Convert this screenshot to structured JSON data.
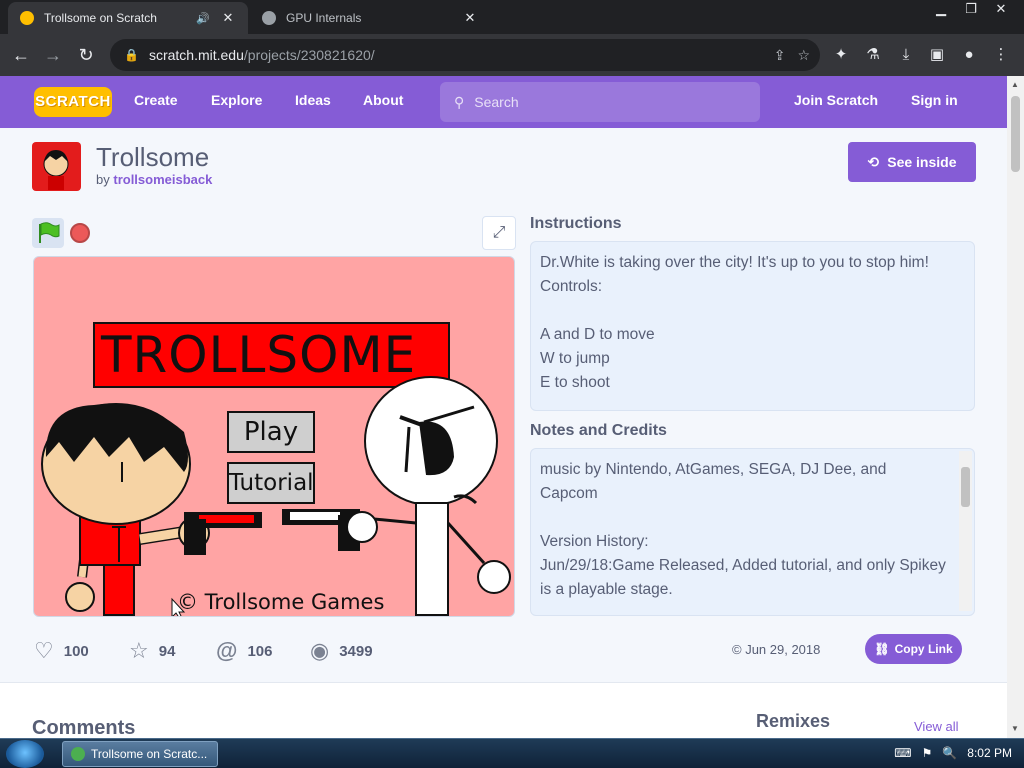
{
  "browser": {
    "tabs": [
      {
        "title": "Trollsome on Scratch",
        "active": true
      },
      {
        "title": "GPU Internals",
        "active": false
      }
    ],
    "url_domain": "scratch.mit.edu",
    "url_path": "/projects/230821620/"
  },
  "nav": {
    "logo": "SCRATCH",
    "links": [
      "Create",
      "Explore",
      "Ideas",
      "About"
    ],
    "search_placeholder": "Search",
    "join": "Join Scratch",
    "signin": "Sign in"
  },
  "project": {
    "title": "Trollsome",
    "by_prefix": "by",
    "author": "trollsomeisback",
    "see_inside": "See inside"
  },
  "stage": {
    "title": "TROLLSOME",
    "play": "Play",
    "tutorial": "Tutorial",
    "credit": "© Trollsome Games"
  },
  "instructions": {
    "label": "Instructions",
    "lines": [
      "Dr.White is taking over the city! It's up to you to stop him!",
      "Controls:",
      "",
      "A and D to move",
      "W to jump",
      "E to shoot"
    ]
  },
  "notes": {
    "label": "Notes and Credits",
    "lines": [
      "music by Nintendo, AtGames, SEGA, DJ Dee, and",
      "Capcom",
      "",
      "Version History:",
      "Jun/29/18:Game Released, Added tutorial, and only Spikey",
      "is a playable stage."
    ]
  },
  "stats": {
    "loves": "100",
    "favorites": "94",
    "remixes": "106",
    "views": "3499"
  },
  "shared_date": "© Jun 29, 2018",
  "copy_link": "Copy Link",
  "sections": {
    "comments": "Comments",
    "remixes": "Remixes",
    "view_all": "View all"
  },
  "taskbar": {
    "item": "Trollsome on Scratc...",
    "time": "8:02 PM"
  },
  "colors": {
    "scratch_purple": "#855cd6",
    "stage_bg": "#ffa4a4",
    "title_red": "#ff0000"
  }
}
